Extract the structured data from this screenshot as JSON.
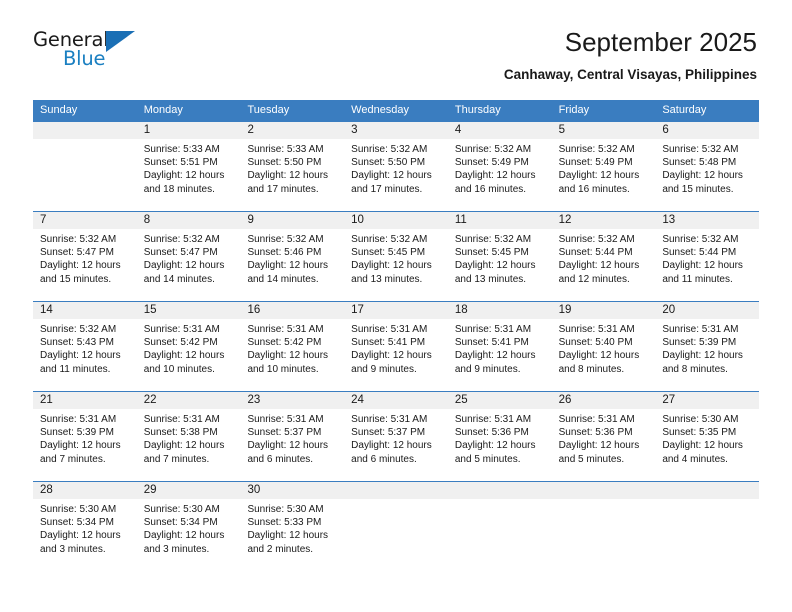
{
  "brand": {
    "name_top": "General",
    "name_bottom": "Blue",
    "triangle_icon": "triangle-icon",
    "color_blue": "#1a7fc1"
  },
  "header": {
    "title": "September 2025",
    "subtitle": "Canhaway, Central Visayas, Philippines"
  },
  "theme": {
    "header_blue": "#3a7dc0",
    "daynum_band": "#f0f0f0",
    "text": "#1a1a1a"
  },
  "weekdays": [
    "Sunday",
    "Monday",
    "Tuesday",
    "Wednesday",
    "Thursday",
    "Friday",
    "Saturday"
  ],
  "weeks": [
    [
      {
        "day": "",
        "sunrise": "",
        "sunset": "",
        "daylight1": "",
        "daylight2": ""
      },
      {
        "day": "1",
        "sunrise": "Sunrise: 5:33 AM",
        "sunset": "Sunset: 5:51 PM",
        "daylight1": "Daylight: 12 hours",
        "daylight2": "and 18 minutes."
      },
      {
        "day": "2",
        "sunrise": "Sunrise: 5:33 AM",
        "sunset": "Sunset: 5:50 PM",
        "daylight1": "Daylight: 12 hours",
        "daylight2": "and 17 minutes."
      },
      {
        "day": "3",
        "sunrise": "Sunrise: 5:32 AM",
        "sunset": "Sunset: 5:50 PM",
        "daylight1": "Daylight: 12 hours",
        "daylight2": "and 17 minutes."
      },
      {
        "day": "4",
        "sunrise": "Sunrise: 5:32 AM",
        "sunset": "Sunset: 5:49 PM",
        "daylight1": "Daylight: 12 hours",
        "daylight2": "and 16 minutes."
      },
      {
        "day": "5",
        "sunrise": "Sunrise: 5:32 AM",
        "sunset": "Sunset: 5:49 PM",
        "daylight1": "Daylight: 12 hours",
        "daylight2": "and 16 minutes."
      },
      {
        "day": "6",
        "sunrise": "Sunrise: 5:32 AM",
        "sunset": "Sunset: 5:48 PM",
        "daylight1": "Daylight: 12 hours",
        "daylight2": "and 15 minutes."
      }
    ],
    [
      {
        "day": "7",
        "sunrise": "Sunrise: 5:32 AM",
        "sunset": "Sunset: 5:47 PM",
        "daylight1": "Daylight: 12 hours",
        "daylight2": "and 15 minutes."
      },
      {
        "day": "8",
        "sunrise": "Sunrise: 5:32 AM",
        "sunset": "Sunset: 5:47 PM",
        "daylight1": "Daylight: 12 hours",
        "daylight2": "and 14 minutes."
      },
      {
        "day": "9",
        "sunrise": "Sunrise: 5:32 AM",
        "sunset": "Sunset: 5:46 PM",
        "daylight1": "Daylight: 12 hours",
        "daylight2": "and 14 minutes."
      },
      {
        "day": "10",
        "sunrise": "Sunrise: 5:32 AM",
        "sunset": "Sunset: 5:45 PM",
        "daylight1": "Daylight: 12 hours",
        "daylight2": "and 13 minutes."
      },
      {
        "day": "11",
        "sunrise": "Sunrise: 5:32 AM",
        "sunset": "Sunset: 5:45 PM",
        "daylight1": "Daylight: 12 hours",
        "daylight2": "and 13 minutes."
      },
      {
        "day": "12",
        "sunrise": "Sunrise: 5:32 AM",
        "sunset": "Sunset: 5:44 PM",
        "daylight1": "Daylight: 12 hours",
        "daylight2": "and 12 minutes."
      },
      {
        "day": "13",
        "sunrise": "Sunrise: 5:32 AM",
        "sunset": "Sunset: 5:44 PM",
        "daylight1": "Daylight: 12 hours",
        "daylight2": "and 11 minutes."
      }
    ],
    [
      {
        "day": "14",
        "sunrise": "Sunrise: 5:32 AM",
        "sunset": "Sunset: 5:43 PM",
        "daylight1": "Daylight: 12 hours",
        "daylight2": "and 11 minutes."
      },
      {
        "day": "15",
        "sunrise": "Sunrise: 5:31 AM",
        "sunset": "Sunset: 5:42 PM",
        "daylight1": "Daylight: 12 hours",
        "daylight2": "and 10 minutes."
      },
      {
        "day": "16",
        "sunrise": "Sunrise: 5:31 AM",
        "sunset": "Sunset: 5:42 PM",
        "daylight1": "Daylight: 12 hours",
        "daylight2": "and 10 minutes."
      },
      {
        "day": "17",
        "sunrise": "Sunrise: 5:31 AM",
        "sunset": "Sunset: 5:41 PM",
        "daylight1": "Daylight: 12 hours",
        "daylight2": "and 9 minutes."
      },
      {
        "day": "18",
        "sunrise": "Sunrise: 5:31 AM",
        "sunset": "Sunset: 5:41 PM",
        "daylight1": "Daylight: 12 hours",
        "daylight2": "and 9 minutes."
      },
      {
        "day": "19",
        "sunrise": "Sunrise: 5:31 AM",
        "sunset": "Sunset: 5:40 PM",
        "daylight1": "Daylight: 12 hours",
        "daylight2": "and 8 minutes."
      },
      {
        "day": "20",
        "sunrise": "Sunrise: 5:31 AM",
        "sunset": "Sunset: 5:39 PM",
        "daylight1": "Daylight: 12 hours",
        "daylight2": "and 8 minutes."
      }
    ],
    [
      {
        "day": "21",
        "sunrise": "Sunrise: 5:31 AM",
        "sunset": "Sunset: 5:39 PM",
        "daylight1": "Daylight: 12 hours",
        "daylight2": "and 7 minutes."
      },
      {
        "day": "22",
        "sunrise": "Sunrise: 5:31 AM",
        "sunset": "Sunset: 5:38 PM",
        "daylight1": "Daylight: 12 hours",
        "daylight2": "and 7 minutes."
      },
      {
        "day": "23",
        "sunrise": "Sunrise: 5:31 AM",
        "sunset": "Sunset: 5:37 PM",
        "daylight1": "Daylight: 12 hours",
        "daylight2": "and 6 minutes."
      },
      {
        "day": "24",
        "sunrise": "Sunrise: 5:31 AM",
        "sunset": "Sunset: 5:37 PM",
        "daylight1": "Daylight: 12 hours",
        "daylight2": "and 6 minutes."
      },
      {
        "day": "25",
        "sunrise": "Sunrise: 5:31 AM",
        "sunset": "Sunset: 5:36 PM",
        "daylight1": "Daylight: 12 hours",
        "daylight2": "and 5 minutes."
      },
      {
        "day": "26",
        "sunrise": "Sunrise: 5:31 AM",
        "sunset": "Sunset: 5:36 PM",
        "daylight1": "Daylight: 12 hours",
        "daylight2": "and 5 minutes."
      },
      {
        "day": "27",
        "sunrise": "Sunrise: 5:30 AM",
        "sunset": "Sunset: 5:35 PM",
        "daylight1": "Daylight: 12 hours",
        "daylight2": "and 4 minutes."
      }
    ],
    [
      {
        "day": "28",
        "sunrise": "Sunrise: 5:30 AM",
        "sunset": "Sunset: 5:34 PM",
        "daylight1": "Daylight: 12 hours",
        "daylight2": "and 3 minutes."
      },
      {
        "day": "29",
        "sunrise": "Sunrise: 5:30 AM",
        "sunset": "Sunset: 5:34 PM",
        "daylight1": "Daylight: 12 hours",
        "daylight2": "and 3 minutes."
      },
      {
        "day": "30",
        "sunrise": "Sunrise: 5:30 AM",
        "sunset": "Sunset: 5:33 PM",
        "daylight1": "Daylight: 12 hours",
        "daylight2": "and 2 minutes."
      },
      {
        "day": "",
        "sunrise": "",
        "sunset": "",
        "daylight1": "",
        "daylight2": ""
      },
      {
        "day": "",
        "sunrise": "",
        "sunset": "",
        "daylight1": "",
        "daylight2": ""
      },
      {
        "day": "",
        "sunrise": "",
        "sunset": "",
        "daylight1": "",
        "daylight2": ""
      },
      {
        "day": "",
        "sunrise": "",
        "sunset": "",
        "daylight1": "",
        "daylight2": ""
      }
    ]
  ]
}
